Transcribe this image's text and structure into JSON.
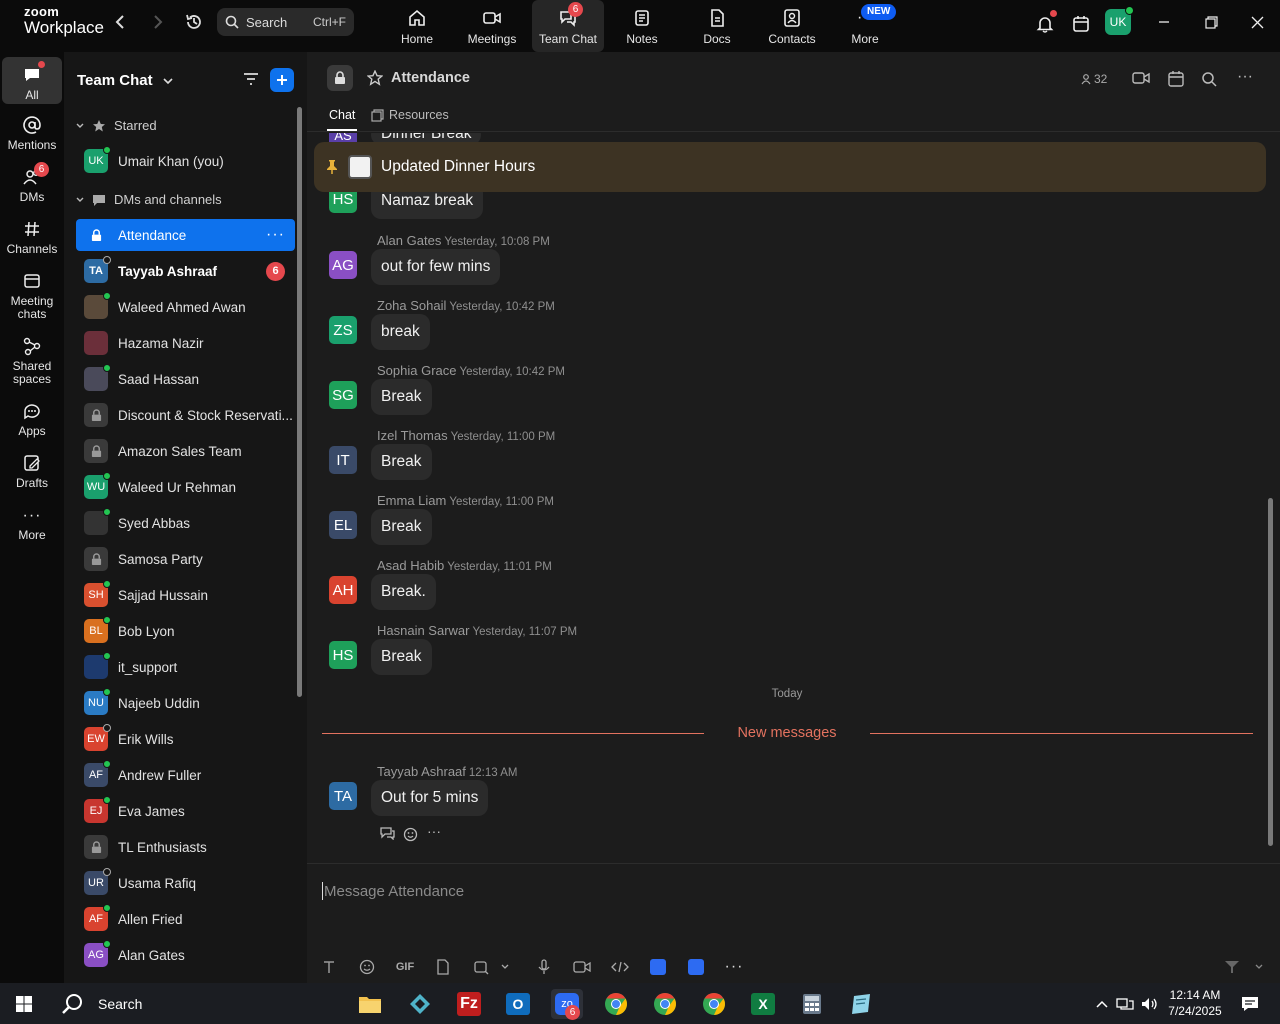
{
  "app": {
    "logo_line1": "zoom",
    "logo_line2": "Workplace",
    "search_label": "Search",
    "search_shortcut": "Ctrl+F"
  },
  "top_tabs": [
    {
      "label": "Home",
      "icon": "home-icon"
    },
    {
      "label": "Meetings",
      "icon": "video-camera-icon"
    },
    {
      "label": "Team Chat",
      "icon": "chat-bubbles-icon",
      "badge": "6",
      "active": true
    },
    {
      "label": "Notes",
      "icon": "notes-icon"
    },
    {
      "label": "Docs",
      "icon": "docs-icon"
    },
    {
      "label": "Contacts",
      "icon": "contacts-icon"
    },
    {
      "label": "More",
      "icon": "more-dots-icon",
      "badge": "NEW"
    }
  ],
  "profile_initials": "UK",
  "rail": [
    {
      "label": "All",
      "icon": "chat-icon",
      "active": true
    },
    {
      "label": "Mentions",
      "icon": "at-icon"
    },
    {
      "label": "DMs",
      "icon": "people-icon",
      "badge": "6"
    },
    {
      "label": "Channels",
      "icon": "hash-icon"
    },
    {
      "label": "Meeting chats",
      "line1": "Meeting",
      "line2": "chats",
      "icon": "calendar-chat-icon"
    },
    {
      "label": "Shared spaces",
      "line1": "Shared",
      "line2": "spaces",
      "icon": "share-icon"
    },
    {
      "label": "Apps",
      "icon": "apps-icon"
    },
    {
      "label": "Drafts",
      "icon": "drafts-icon"
    },
    {
      "label": "More",
      "icon": "more-icon"
    }
  ],
  "sidebar": {
    "title": "Team Chat",
    "starred_label": "Starred",
    "starred": [
      {
        "name": "Umair Khan (you)",
        "initials": "UK",
        "color": "#1aa06d",
        "status": "online"
      }
    ],
    "dms_label": "DMs and channels",
    "items": [
      {
        "name": "Attendance",
        "type": "channel",
        "selected": true
      },
      {
        "name": "Tayyab Ashraaf",
        "initials": "TA",
        "color": "#2d6ba3",
        "status": "away",
        "badge": "6",
        "bold": true
      },
      {
        "name": "Waleed Ahmed Awan",
        "initials": "",
        "color": "#5a4a3a",
        "status": "online"
      },
      {
        "name": "Hazama Nazir",
        "initials": "",
        "color": "#6b2f3a",
        "status": "none"
      },
      {
        "name": "Saad Hassan",
        "initials": "",
        "color": "#4a4a5a",
        "status": "online"
      },
      {
        "name": "Discount & Stock Reservati...",
        "type": "channel"
      },
      {
        "name": "Amazon Sales Team",
        "type": "channel"
      },
      {
        "name": "Waleed Ur Rehman",
        "initials": "WU",
        "color": "#1aa06d",
        "status": "online"
      },
      {
        "name": "Syed Abbas",
        "initials": "",
        "color": "#333",
        "status": "online"
      },
      {
        "name": "Samosa Party",
        "type": "channel"
      },
      {
        "name": "Sajjad Hussain",
        "initials": "SH",
        "color": "#d9502f",
        "status": "online-mobile"
      },
      {
        "name": "Bob Lyon",
        "initials": "BL",
        "color": "#d9701f",
        "status": "online"
      },
      {
        "name": "it_support",
        "initials": "",
        "color": "#1d3a6e",
        "status": "online-mobile"
      },
      {
        "name": "Najeeb Uddin",
        "initials": "NU",
        "color": "#2a7bc4",
        "status": "online"
      },
      {
        "name": "Erik Wills",
        "initials": "EW",
        "color": "#d9432f",
        "status": "away"
      },
      {
        "name": "Andrew Fuller",
        "initials": "AF",
        "color": "#3a4a68",
        "status": "online"
      },
      {
        "name": "Eva James",
        "initials": "EJ",
        "color": "#c8362f",
        "status": "online"
      },
      {
        "name": "TL Enthusiasts",
        "type": "channel"
      },
      {
        "name": "Usama Rafiq",
        "initials": "UR",
        "color": "#3a4a68",
        "status": "away"
      },
      {
        "name": "Allen Fried",
        "initials": "AF",
        "color": "#d9432f",
        "status": "online"
      },
      {
        "name": "Alan Gates",
        "initials": "AG",
        "color": "#8a4fc4",
        "status": "online"
      }
    ]
  },
  "channel": {
    "name": "Attendance",
    "members": "32",
    "tab_chat": "Chat",
    "tab_resources": "Resources",
    "pinned": "Updated Dinner Hours",
    "cutoff_initials": "AS",
    "cutoff_text": "Dinner Break",
    "first_bubble": {
      "initials": "HS",
      "color": "#1ea05a",
      "text": "Namaz break"
    },
    "messages": [
      {
        "sender": "Alan Gates",
        "time": "Yesterday, 10:08 PM",
        "initials": "AG",
        "color": "#8a4fc4",
        "text": "out for few mins"
      },
      {
        "sender": "Zoha Sohail",
        "time": "Yesterday, 10:42 PM",
        "initials": "ZS",
        "color": "#1aa06d",
        "text": "break"
      },
      {
        "sender": "Sophia Grace",
        "time": "Yesterday, 10:42 PM",
        "initials": "SG",
        "color": "#1ea05a",
        "text": "Break"
      },
      {
        "sender": "Izel Thomas",
        "time": "Yesterday, 11:00 PM",
        "initials": "IT",
        "color": "#3a4a68",
        "text": "Break"
      },
      {
        "sender": "Emma Liam",
        "time": "Yesterday, 11:00 PM",
        "initials": "EL",
        "color": "#3a4a68",
        "text": "Break"
      },
      {
        "sender": "Asad Habib",
        "time": "Yesterday, 11:01 PM",
        "initials": "AH",
        "color": "#d9432f",
        "text": "Break."
      },
      {
        "sender": "Hasnain Sarwar",
        "time": "Yesterday, 11:07 PM",
        "initials": "HS",
        "color": "#1ea05a",
        "text": "Break"
      }
    ],
    "today_label": "Today",
    "new_messages_label": "New messages",
    "latest": {
      "sender": "Tayyab Ashraaf",
      "time": "12:13 AM",
      "initials": "TA",
      "color": "#2d6ba3",
      "text": "Out for 5 mins"
    },
    "composer_placeholder": "Message Attendance",
    "gif_label": "GIF"
  },
  "taskbar": {
    "search_label": "Search",
    "time": "12:14 AM",
    "date": "7/24/2025",
    "zoom_badge": "6"
  },
  "colors": {
    "accent": "#0e72ed",
    "badge": "#e5484d",
    "online": "#23c552",
    "new_messages": "#e3725f"
  }
}
